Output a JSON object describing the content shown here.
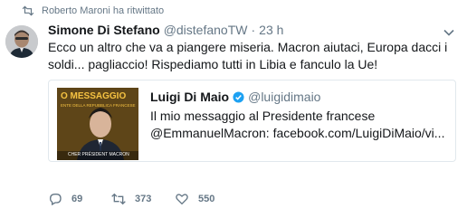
{
  "retweet_context": {
    "text": "Roberto Maroni ha ritwittato"
  },
  "tweet": {
    "fullname": "Simone Di Stefano",
    "username": "@distefanoTW",
    "separator": "·",
    "time": "23 h",
    "text": "Ecco un altro che va a piangere miseria. Macron aiutaci, Europa dacci i soldi... pagliaccio! Rispediamo tutti in Libia e fanculo la Ue!"
  },
  "quoted_tweet": {
    "fullname": "Luigi Di Maio",
    "username": "@luigidimaio",
    "text_line1": "Il mio messaggio al Presidente francese",
    "text_line2": "@EmmanuelMacron: facebook.com/LuigiDiMaio/vi...",
    "media": {
      "headline": "O MESSAGGIO",
      "subline": "ENTE DELLA REPUBBLICA FRANCESE",
      "caption": "CHER PRÉSIDENT MACRON"
    }
  },
  "actions": {
    "replies": "69",
    "retweets": "373",
    "likes": "550"
  },
  "colors": {
    "muted": "#657786",
    "verified": "#1da1f2",
    "media_bg": "#5b4418",
    "media_text": "#f5c242"
  },
  "icons": [
    "retweet-icon",
    "chevron-down-icon",
    "verified-badge-icon",
    "reply-icon",
    "like-icon"
  ]
}
